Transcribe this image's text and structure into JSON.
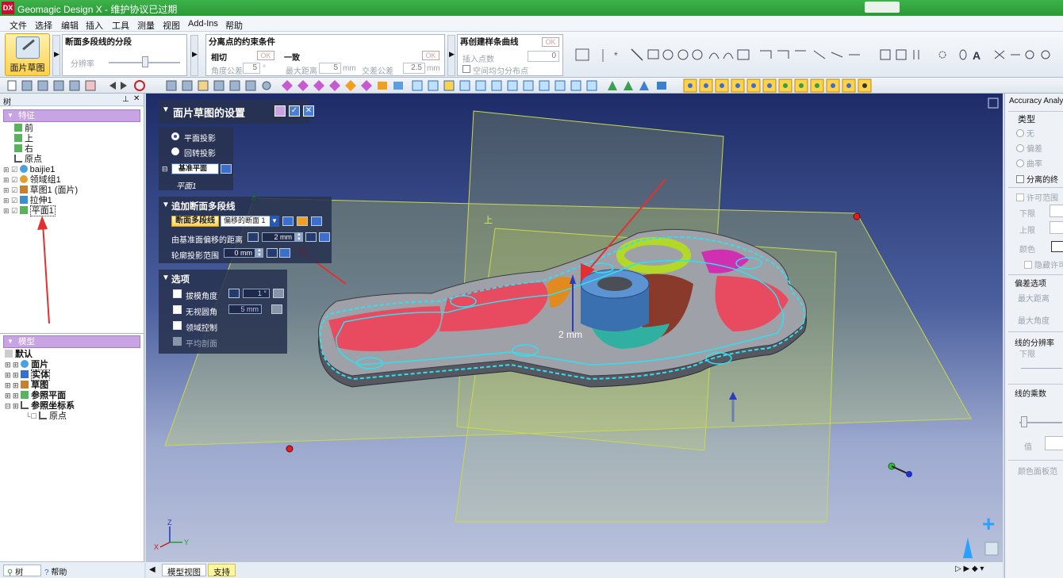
{
  "window": {
    "logo": "DX",
    "title": "Geomagic Design X - 维护协议已过期"
  },
  "menu": [
    "文件",
    "选择",
    "编辑",
    "插入",
    "工具",
    "测量",
    "视图",
    "Add-Ins",
    "帮助"
  ],
  "ribbon": {
    "big_button": "面片草图",
    "group1": {
      "title": "断面多段线的分段",
      "label": "分辨率"
    },
    "group2": {
      "title": "分离点的约束条件",
      "tangent": {
        "title": "相切",
        "ok": "OK",
        "angle_label": "角度公差",
        "angle_value": "5",
        "angle_unit": "°"
      },
      "consistent": {
        "title": "一致",
        "ok": "OK",
        "maxdist_label": "最大距离",
        "maxdist_value": "5",
        "maxdist_unit": "mm",
        "cross_label": "交差公差",
        "cross_value": "2.5",
        "cross_unit": "mm"
      }
    },
    "group3": {
      "title": "再创建样条曲线",
      "ok": "OK",
      "insert_label": "插入点数",
      "insert_value": "0",
      "uniform_label": "空间均匀分布点"
    }
  },
  "tree_panel": {
    "title": "树",
    "features_header": "特征",
    "features": [
      "前",
      "上",
      "右",
      "原点",
      "baijie1",
      "领域组1",
      "草图1 (面片)",
      "拉伸1",
      "平面1"
    ],
    "model_header": "模型",
    "model_items": [
      "默认",
      "面片",
      "实体",
      "草图",
      "参照平面",
      "参照坐标系",
      "原点"
    ]
  },
  "dialog": {
    "title": "面片草图的设置",
    "plane_projection": "平面投影",
    "rotation_projection": "回转投影",
    "base_plane_label": "基准平面",
    "base_plane_value": "平面1",
    "section_title": "追加断面多段线",
    "section_button": "断面多段线",
    "offset_select": "偏移的断面 1",
    "offset_label": "由基准面偏移的距离",
    "offset_value": "2 mm",
    "contour_label": "轮廓投影范围",
    "contour_value": "0 mm",
    "options_title": "选项",
    "draft_angle": "拔模角度",
    "draft_value": "1 °",
    "invisible_fillet": "无视圆角",
    "fillet_value": "5 mm",
    "region_control": "领域控制",
    "avg_section": "平均剖面"
  },
  "viewport": {
    "plane_label": "上",
    "dimension": "2 mm"
  },
  "bottom_left": {
    "tab_tree": "树",
    "tab_help": "帮助"
  },
  "bottom_tabs": [
    "模型视图",
    "支持"
  ],
  "right_panel": {
    "title": "Accuracy Analyzer",
    "type_label": "类型",
    "none": "无",
    "deviation": "偏差",
    "curvature": "曲率",
    "separated": "分离的终",
    "tolerance_range": "许可范围",
    "lower": "下限",
    "upper": "上限",
    "color": "颜色",
    "hide_tol": "隐藏许可",
    "deviation_opts": "偏差选项",
    "max_dist": "最大距离",
    "max_angle": "最大角度",
    "line_res": "线的分辨率",
    "res_low": "下限",
    "line_mult": "线的乘数",
    "value": "值",
    "color_panel": "颜色面板范"
  },
  "colors": {
    "title_green": "#2fa33c",
    "section_purple": "#c9a4e4",
    "selected_gold": "#ffd24d",
    "arrow_red": "#e23030"
  }
}
